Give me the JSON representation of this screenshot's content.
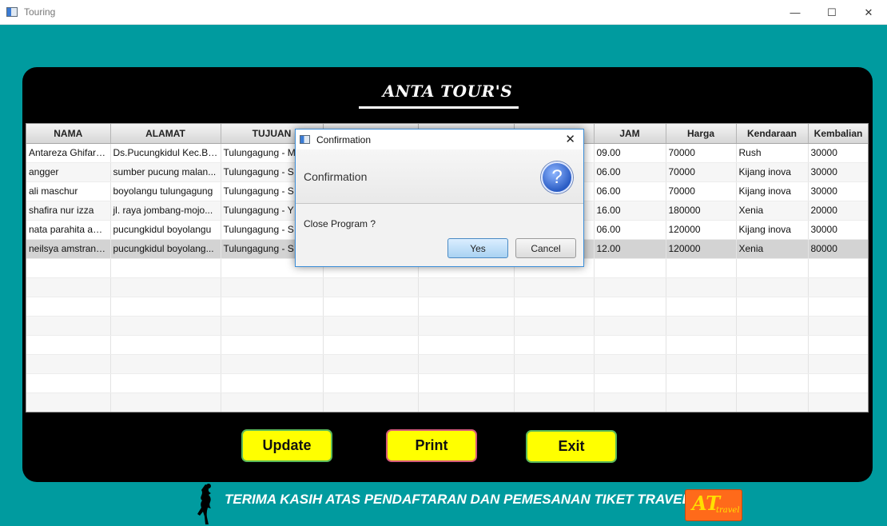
{
  "window": {
    "title": "Touring",
    "controls": [
      "—",
      "☐",
      "✕"
    ]
  },
  "brand": {
    "name": "ANTA TOUR'S"
  },
  "table": {
    "columns": [
      "NAMA",
      "ALAMAT",
      "TUJUAN",
      "",
      "",
      "",
      "JAM",
      "Harga",
      "Kendaraan",
      "Kembalian"
    ],
    "rows": [
      [
        "Antareza Ghifary...",
        "Ds.Pucungkidul Kec.Bo...",
        "Tulungagung - M",
        "",
        "",
        "",
        "09.00",
        "70000",
        "Rush",
        "30000"
      ],
      [
        "angger",
        "sumber pucung malan...",
        "Tulungagung - S",
        "",
        "",
        "",
        "06.00",
        "70000",
        "Kijang inova",
        "30000"
      ],
      [
        "ali maschur",
        "boyolangu tulungagung",
        "Tulungagung - S",
        "",
        "",
        "",
        "06.00",
        "70000",
        "Kijang inova",
        "30000"
      ],
      [
        "shafira nur izza",
        "jl. raya jombang-mojo...",
        "Tulungagung - Y",
        "",
        "",
        "",
        "16.00",
        "180000",
        "Xenia",
        "20000"
      ],
      [
        "nata parahita ani...",
        "pucungkidul boyolangu",
        "Tulungagung - S",
        "",
        "",
        "",
        "06.00",
        "120000",
        "Kijang inova",
        "30000"
      ],
      [
        "neilsya amstrani ...",
        "pucungkidul boyolang...",
        "Tulungagung - S",
        "",
        "",
        "",
        "12.00",
        "120000",
        "Xenia",
        "80000"
      ]
    ],
    "selected_row": 5
  },
  "buttons": {
    "update": "Update",
    "print": "Print",
    "exit": "Exit"
  },
  "footer": {
    "message": "TERIMA KASIH ATAS PENDAFTARAN DAN PEMESANAN TIKET TRAVEL",
    "logo_mark": "AT",
    "logo_word": "travel"
  },
  "dialog": {
    "title": "Confirmation",
    "header": "Confirmation",
    "question_icon": "?",
    "message": "Close Program ?",
    "yes_label": "Yes",
    "cancel_label": "Cancel"
  },
  "colors": {
    "background": "#009b9f",
    "panel": "#000000",
    "button": "#ffff00",
    "logo": "#ff6a1a"
  }
}
